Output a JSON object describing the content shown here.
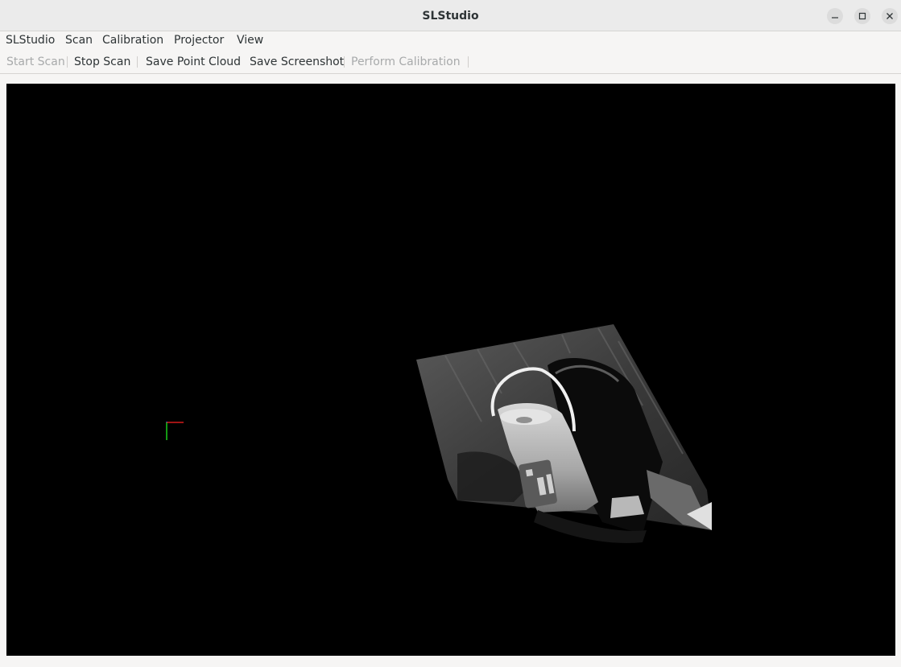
{
  "window": {
    "title": "SLStudio",
    "controls": [
      "minimize-icon",
      "maximize-icon",
      "close-icon"
    ]
  },
  "menubar": {
    "items": [
      {
        "label": "SLStudio"
      },
      {
        "label": "Scan"
      },
      {
        "label": "Calibration"
      },
      {
        "label": "Projector"
      },
      {
        "label": "View"
      }
    ]
  },
  "toolbar": {
    "start_scan": "Start Scan",
    "stop_scan": "Stop Scan",
    "save_point_cloud": "Save Point Cloud",
    "save_screenshot": "Save Screenshot",
    "perform_calibration": "Perform Calibration",
    "disabled": [
      "Start Scan",
      "Perform Calibration"
    ]
  },
  "viewport": {
    "background": "#000000",
    "content": "point-cloud",
    "axes_colors": {
      "x": "#ff2020",
      "y": "#20ff20",
      "z": "#4060ff"
    }
  }
}
